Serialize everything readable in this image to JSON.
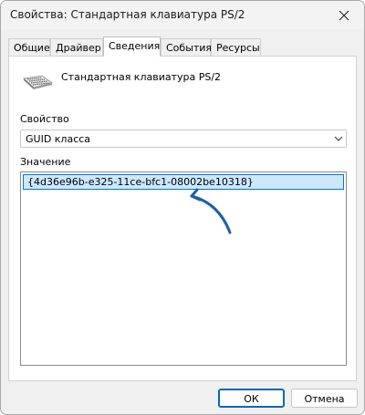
{
  "window": {
    "title": "Свойства: Стандартная клавиатура PS/2"
  },
  "tabs": [
    {
      "label": "Общие",
      "active": false
    },
    {
      "label": "Драйвер",
      "active": false
    },
    {
      "label": "Сведения",
      "active": true
    },
    {
      "label": "События",
      "active": false
    },
    {
      "label": "Ресурсы",
      "active": false
    }
  ],
  "device": {
    "icon": "keyboard-icon",
    "name": "Стандартная клавиатура PS/2"
  },
  "property": {
    "label": "Свойство",
    "selected": "GUID класса"
  },
  "value": {
    "label": "Значение",
    "items": [
      "{4d36e96b-e325-11ce-bfc1-08002be10318}"
    ]
  },
  "buttons": {
    "ok": "ОК",
    "cancel": "Отмена"
  },
  "colors": {
    "selection_fill": "#cce8ff",
    "selection_border": "#0078d7",
    "annotation_arrow": "#1f5fa8"
  }
}
